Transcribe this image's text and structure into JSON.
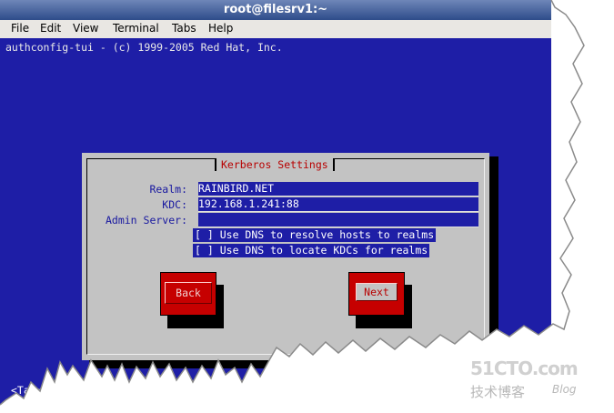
{
  "window": {
    "title": "root@filesrv1:~"
  },
  "menu": [
    "File",
    "Edit",
    "View",
    "Terminal",
    "Tabs",
    "Help"
  ],
  "terminal": {
    "header": "authconfig-tui - (c) 1999-2005 Red Hat, Inc.",
    "status_line": "<Tab>/<Alt-Tab> between elements"
  },
  "dialog": {
    "title": "Kerberos Settings",
    "fields": [
      {
        "label": "Realm:",
        "value": "RAINBIRD.NET"
      },
      {
        "label": "KDC:",
        "value": "192.168.1.241:88"
      },
      {
        "label": "Admin Server:",
        "value": ""
      }
    ],
    "checkboxes": [
      {
        "mark": "[ ]",
        "label": "Use DNS to resolve hosts to realms",
        "checked": false
      },
      {
        "mark": "[ ]",
        "label": "Use DNS to locate KDCs for realms",
        "checked": false
      }
    ],
    "buttons": {
      "back": "Back",
      "next": "Next"
    }
  },
  "watermark": {
    "logo": "51CTO.com",
    "subtitle": "技术博客",
    "blog": "Blog"
  },
  "colors": {
    "terminal_bg": "#1e1ea6",
    "dialog_bg": "#c3c3c3",
    "button_red": "#c60000",
    "title_red": "#b80000"
  }
}
